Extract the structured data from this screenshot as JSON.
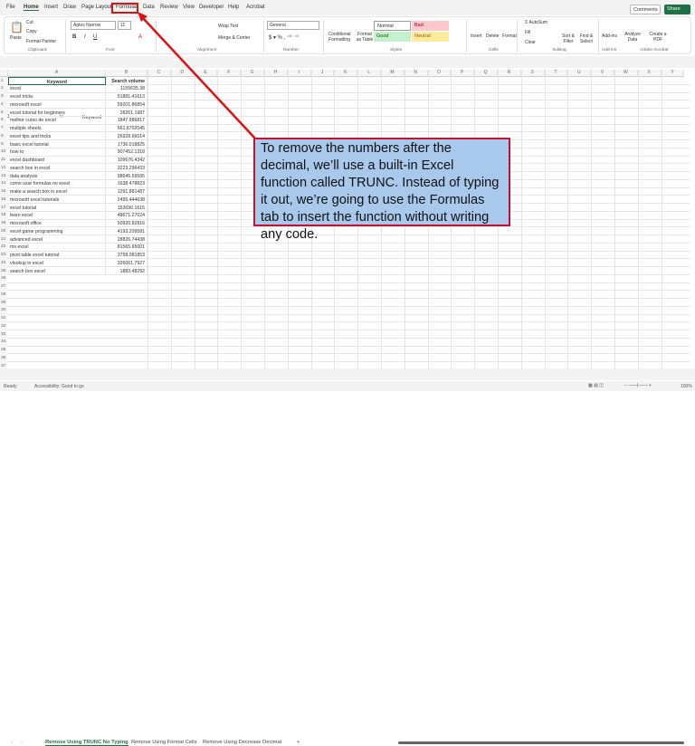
{
  "menu": {
    "tabs": [
      "File",
      "Home",
      "Insert",
      "Draw",
      "Page Layout",
      "Formulas",
      "Data",
      "Review",
      "View",
      "Developer",
      "Help",
      "Acrobat"
    ],
    "active": "Home",
    "highlighted": "Formulas",
    "comments": "Comments",
    "share": "Share"
  },
  "ribbon": {
    "clipboard": {
      "paste": "Paste",
      "cut": "Cut",
      "copy": "Copy",
      "format_painter": "Format Painter",
      "label": "Clipboard"
    },
    "font": {
      "name": "Aptos Narrow",
      "size": "11",
      "label": "Font"
    },
    "alignment": {
      "wrap": "Wrap Text",
      "merge": "Merge & Center",
      "label": "Alignment"
    },
    "number": {
      "format": "General",
      "label": "Number"
    },
    "styles": {
      "conditional": "Conditional Formatting",
      "format_table": "Format as Table",
      "normal": "Normal",
      "bad": "Bad",
      "good": "Good",
      "neutral": "Neutral",
      "label": "Styles"
    },
    "cells": {
      "insert": "Insert",
      "delete": "Delete",
      "format": "Format",
      "label": "Cells"
    },
    "editing": {
      "autosum": "AutoSum",
      "fill": "Fill",
      "clear": "Clear",
      "sort": "Sort & Filter",
      "find": "Find & Select",
      "label": "Editing"
    },
    "addins": {
      "addins": "Add-ins",
      "label": "Add-ins"
    },
    "analyze": {
      "label": "Analyze Data"
    },
    "acrobat": {
      "create": "Create a PDF",
      "label": "Adobe Acrobat"
    }
  },
  "formula_bar": {
    "cell": "A1",
    "fx": "fx",
    "value": "Keyword"
  },
  "columns": [
    "A",
    "B",
    "C",
    "D",
    "E",
    "F",
    "G",
    "H",
    "I",
    "J",
    "K",
    "L",
    "M",
    "N",
    "O",
    "P",
    "Q",
    "R",
    "S",
    "T",
    "U",
    "V",
    "W",
    "X",
    "Y"
  ],
  "table": {
    "headers": [
      "Keyword",
      "Search volume"
    ],
    "rows": [
      [
        "excel",
        "1155635.38"
      ],
      [
        "excel tricks",
        "51881.41613"
      ],
      [
        "microsoft excel",
        "59201.86854"
      ],
      [
        "excel tutorial for beginners",
        "28261.1987"
      ],
      [
        "melhor curso de excel",
        "1847.986817"
      ],
      [
        "multiple sheets",
        "661.8702045"
      ],
      [
        "excel tips and tricks",
        "26928.66014"
      ],
      [
        "basic excel tutorial",
        "1736.018825"
      ],
      [
        "how to",
        "907452.1318"
      ],
      [
        "excel dashboard",
        "109676.4342"
      ],
      [
        "search box in excel",
        "3223.296433"
      ],
      [
        "data analysis",
        "98645.69595"
      ],
      [
        "como usar formulas no excel",
        "1638.478823"
      ],
      [
        "make a search box in excel",
        "1291.881487"
      ],
      [
        "microsoft excel tutorials",
        "2495.444638"
      ],
      [
        "excel tutorial",
        "153690.1615"
      ],
      [
        "learn excel",
        "48671.27024"
      ],
      [
        "microsoft office",
        "50920.82816"
      ],
      [
        "excel game programming",
        "4193.209581"
      ],
      [
        "advanced excel",
        "28826.74438"
      ],
      [
        "ms excel",
        "81565.65001"
      ],
      [
        "pivot table excel tutorial",
        "3758.081853"
      ],
      [
        "vlookup in excel",
        "326061.7927"
      ],
      [
        "search box excel",
        "1883.48292"
      ]
    ]
  },
  "callout": "To remove the numbers after the decimal, we’ll use a built-in Excel function called TRUNC. Instead of typing it out, we’re going to use the Formulas tab to insert the function without writing any code.",
  "sheets": [
    "Remove Using TRUNC No Typing",
    "Remove Using Format Cells",
    "Remove Using Decrease Decimal"
  ],
  "add_sheet": "+",
  "status": {
    "ready": "Ready",
    "accessibility": "Accessibility: Good to go",
    "zoom": "100%"
  },
  "colors": {
    "accent": "#1e7145",
    "callout_bg": "#a9c9ec",
    "annotation_red": "#c8102e"
  }
}
